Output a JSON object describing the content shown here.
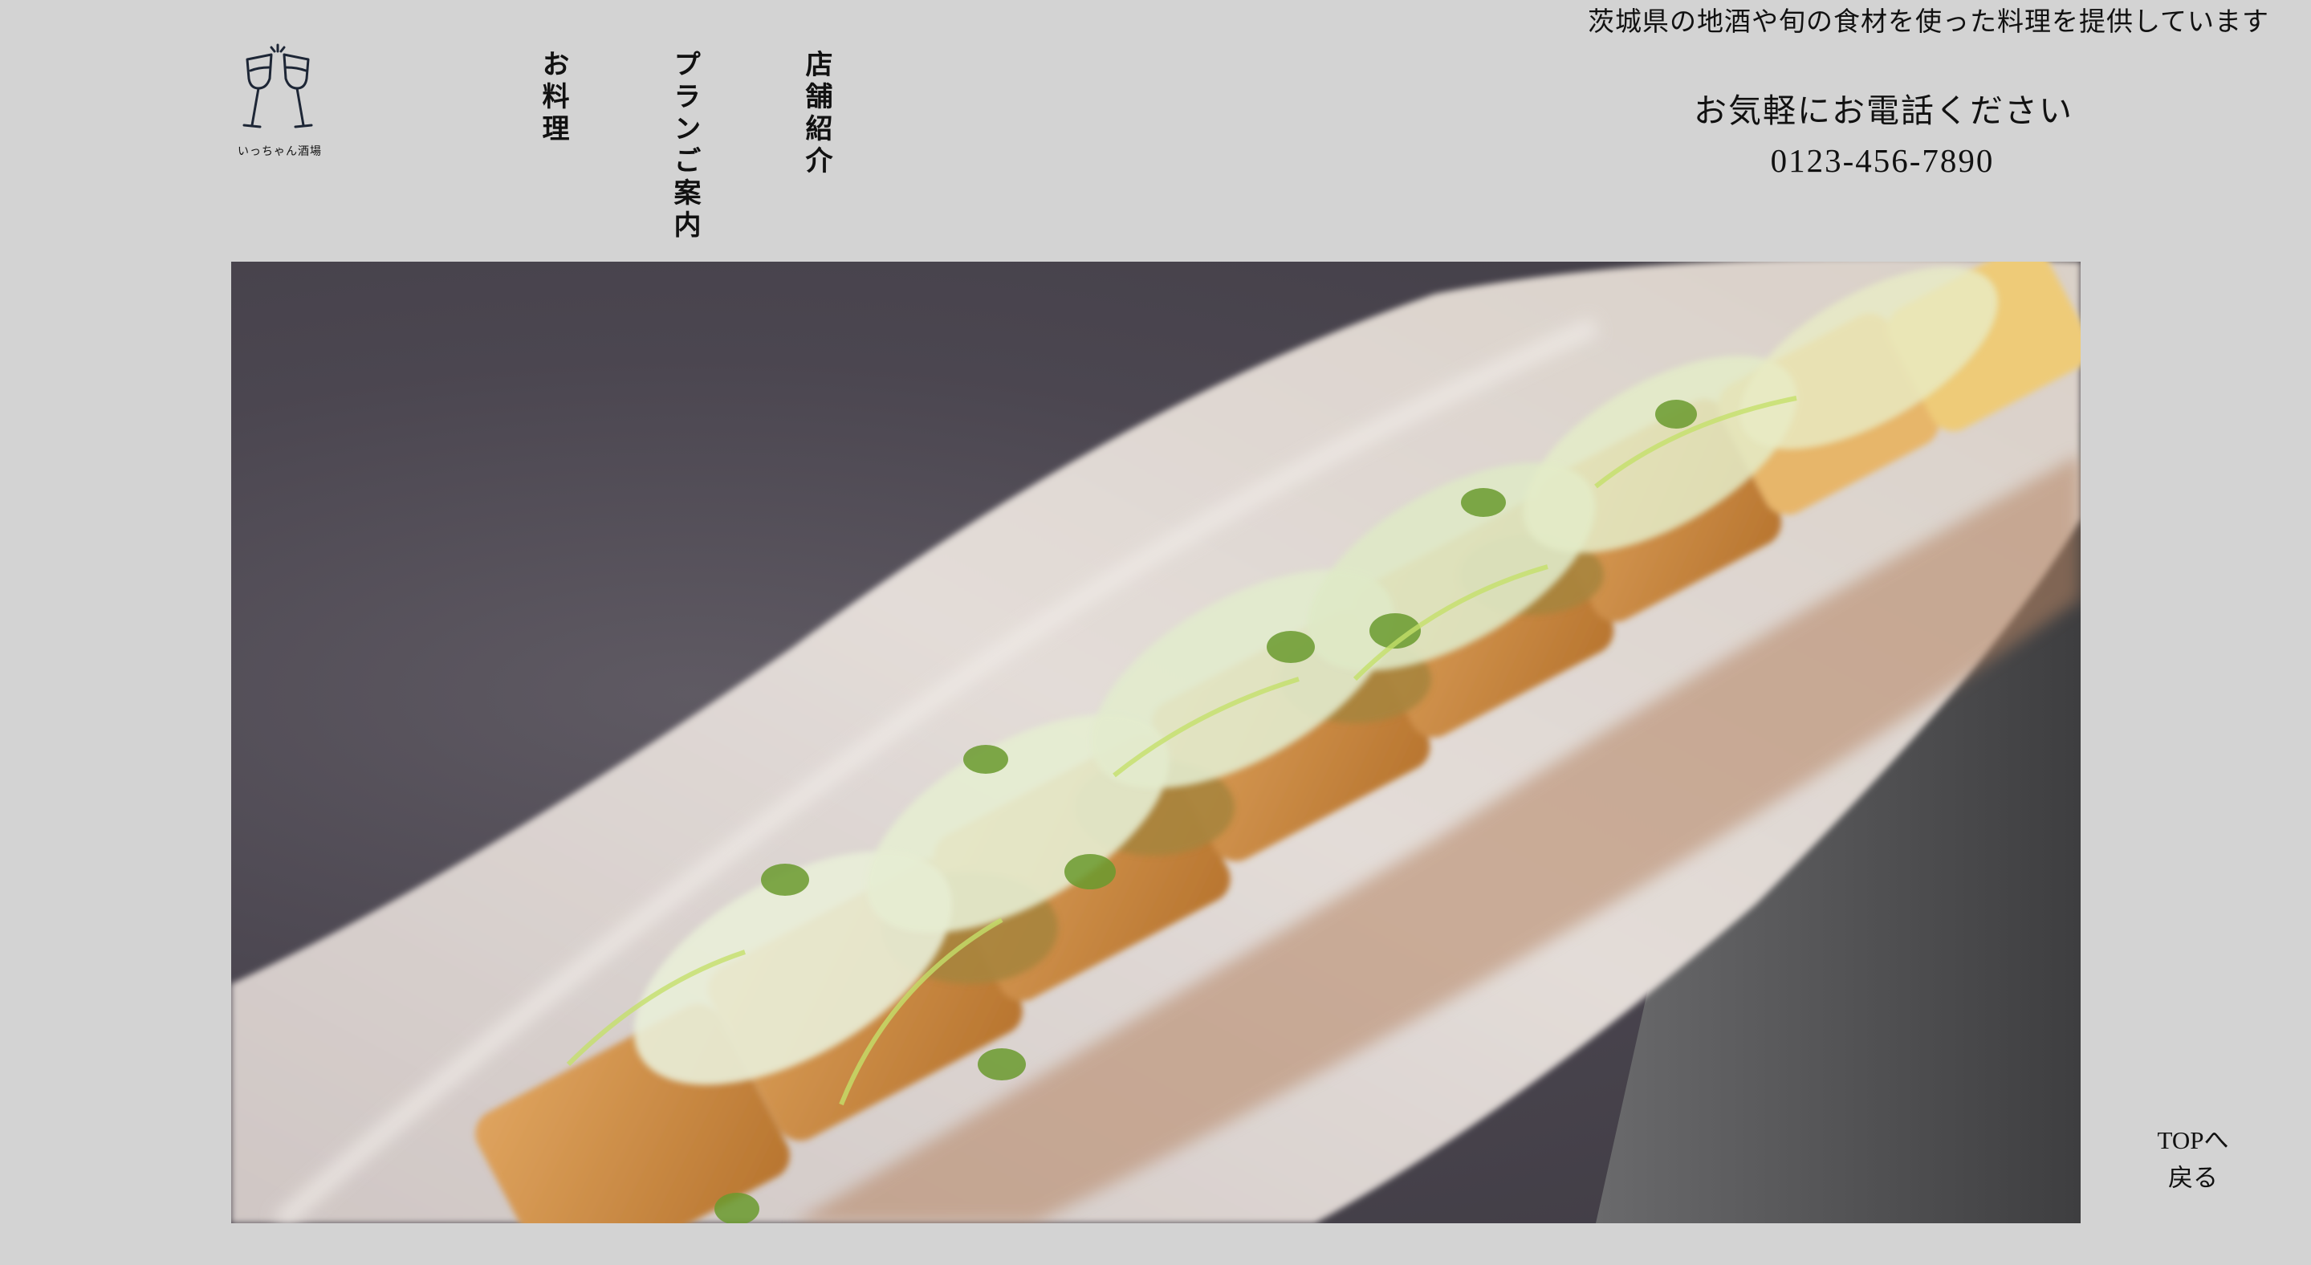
{
  "header": {
    "tagline": "茨城県の地酒や旬の食材を使った料理を提供しています",
    "logo": {
      "icon": "wine-glasses-toast-icon",
      "text": "いっちゃん酒場"
    },
    "nav": [
      {
        "label": "お料理"
      },
      {
        "label": "プランご案内"
      },
      {
        "label": "店舗紹介"
      }
    ],
    "contact": {
      "label": "お気軽にお電話ください",
      "phone": "0123-456-7890"
    }
  },
  "hero": {
    "image": "food-photo-fried-tofu-with-natto-and-green-onion"
  },
  "footer": {
    "to_top_line1": "TOPへ",
    "to_top_line2": "戻る"
  },
  "colors": {
    "background": "#d3d3d3",
    "text": "#111111"
  }
}
